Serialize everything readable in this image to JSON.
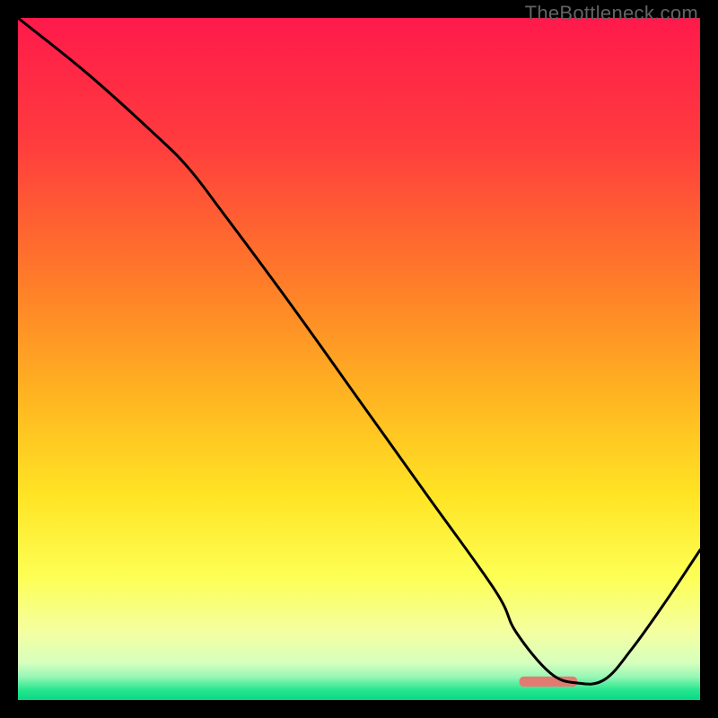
{
  "watermark": "TheBottleneck.com",
  "chart_data": {
    "type": "line",
    "title": "",
    "xlabel": "",
    "ylabel": "",
    "xlim": [
      0,
      100
    ],
    "ylim": [
      0,
      100
    ],
    "gradient_stops": [
      {
        "offset": 0.0,
        "color": "#ff1a4b"
      },
      {
        "offset": 0.18,
        "color": "#ff3b3e"
      },
      {
        "offset": 0.38,
        "color": "#ff7a2a"
      },
      {
        "offset": 0.55,
        "color": "#ffb321"
      },
      {
        "offset": 0.7,
        "color": "#ffe424"
      },
      {
        "offset": 0.82,
        "color": "#fdff55"
      },
      {
        "offset": 0.9,
        "color": "#f4ffa0"
      },
      {
        "offset": 0.945,
        "color": "#d7ffbd"
      },
      {
        "offset": 0.965,
        "color": "#9bf7b6"
      },
      {
        "offset": 0.985,
        "color": "#28e78f"
      },
      {
        "offset": 1.0,
        "color": "#06d885"
      }
    ],
    "curve": {
      "x": [
        0,
        10,
        20,
        25,
        30,
        40,
        50,
        60,
        70,
        73,
        78,
        82,
        86,
        90,
        95,
        100
      ],
      "y_from_top_pct": [
        0.0,
        8.0,
        17.0,
        22.0,
        28.5,
        42.0,
        56.0,
        70.0,
        84.0,
        90.0,
        96.0,
        97.5,
        97.0,
        92.5,
        85.5,
        78.0
      ]
    },
    "optimal_band": {
      "x_start_pct": 73.5,
      "x_end_pct": 82.0,
      "y_from_top_pct": 97.3,
      "thickness_pct": 1.5,
      "color": "#e27a72"
    }
  }
}
